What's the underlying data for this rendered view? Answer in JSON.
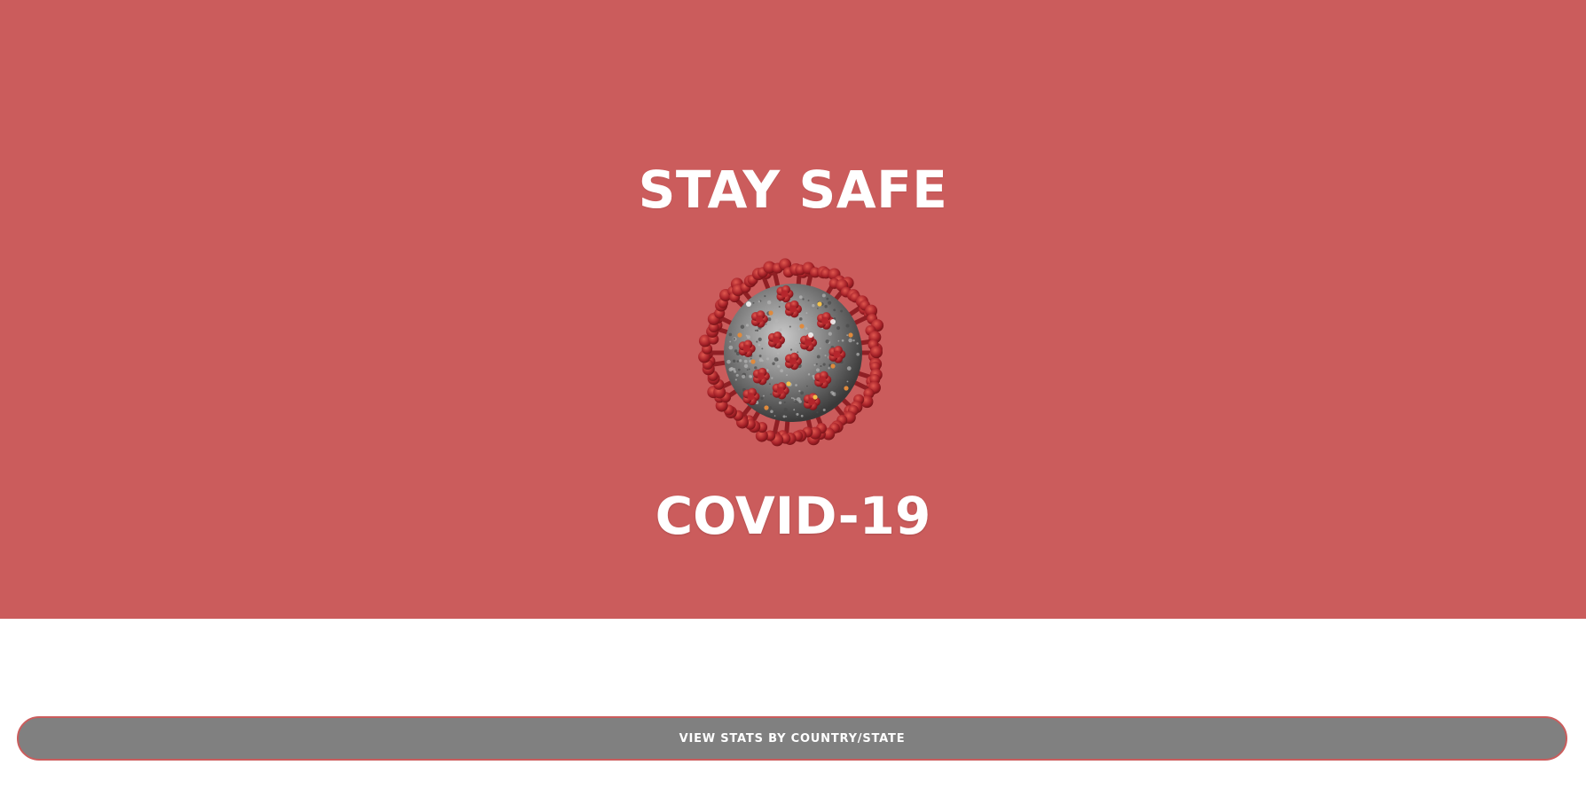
{
  "hero": {
    "title": "STAY SAFE",
    "image": "coronavirus-illustration",
    "subtitle": "COVID-19",
    "background_color": "#cb5c5c"
  },
  "actions": {
    "view_stats_label": "VIEW STATS BY COUNTRY/STATE",
    "button_color": "#808080"
  }
}
